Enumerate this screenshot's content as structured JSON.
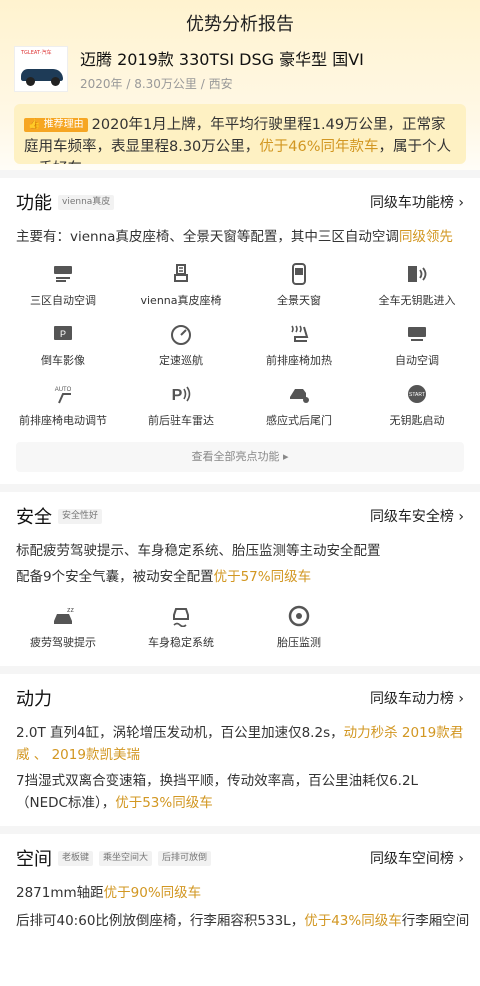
{
  "header": {
    "title": "优势分析报告"
  },
  "car": {
    "thumb_tag": "TGLEAT·汽车",
    "name": "迈腾 2019款 330TSI DSG 豪华型 国VI",
    "meta": "2020年 / 8.30万公里 / 西安"
  },
  "recommend": {
    "badge": "推荐理由",
    "text1": "2020年1月上牌，年平均行驶里程1.49万公里，正常家庭用车频率，表显里程8.30万公里，",
    "highlight": "优于46%同年款车",
    "text2": "，属于个人一手好车"
  },
  "function": {
    "title": "功能",
    "chip": "vienna真皮",
    "rank": "同级车功能榜 ›",
    "summary": "主要有：vienna真皮座椅、全景天窗等配置，其中三区自动空调",
    "summary_hl": "同级领先",
    "features": [
      {
        "label": "三区自动空调",
        "icon": "climate-icon"
      },
      {
        "label": "vienna真皮座椅",
        "icon": "seat-icon"
      },
      {
        "label": "全景天窗",
        "icon": "sunroof-icon"
      },
      {
        "label": "全车无钥匙进入",
        "icon": "keyless-entry-icon"
      },
      {
        "label": "倒车影像",
        "icon": "reverse-camera-icon"
      },
      {
        "label": "定速巡航",
        "icon": "cruise-icon"
      },
      {
        "label": "前排座椅加热",
        "icon": "seat-heat-icon"
      },
      {
        "label": "自动空调",
        "icon": "auto-ac-icon"
      },
      {
        "label": "前排座椅电动调节",
        "icon": "power-seat-icon"
      },
      {
        "label": "前后驻车雷达",
        "icon": "parking-radar-icon"
      },
      {
        "label": "感应式后尾门",
        "icon": "tailgate-icon"
      },
      {
        "label": "无钥匙启动",
        "icon": "start-button-icon"
      }
    ],
    "more": "查看全部亮点功能 ▸"
  },
  "safety": {
    "title": "安全",
    "chip": "安全性好",
    "rank": "同级车安全榜 ›",
    "line1": "标配疲劳驾驶提示、车身稳定系统、胎压监测等主动安全配置",
    "line2": "配备9个安全气囊，被动安全配置",
    "line2_hl": "优于57%同级车",
    "features": [
      {
        "label": "疲劳驾驶提示",
        "icon": "fatigue-icon"
      },
      {
        "label": "车身稳定系统",
        "icon": "esp-icon"
      },
      {
        "label": "胎压监测",
        "icon": "tire-pressure-icon"
      }
    ]
  },
  "power": {
    "title": "动力",
    "rank": "同级车动力榜 ›",
    "p1a": "2.0T 直列4缸，涡轮增压发动机，百公里加速仅8.2s，",
    "p1hl": "动力秒杀 2019款君威 、 2019款凯美瑞",
    "p2a": "7挡湿式双离合变速箱，换挡平顺，传动效率高，百公里油耗仅6.2L（NEDC标准），",
    "p2hl": "优于53%同级车"
  },
  "space": {
    "title": "空间",
    "chips": [
      "老板键",
      "乘坐空间大",
      "后排可放倒"
    ],
    "rank": "同级车空间榜 ›",
    "l1a": "2871mm轴距",
    "l1hl": "优于90%同级车",
    "l2a": "后排可40:60比例放倒座椅，行李厢容积533L，",
    "l2hl": "优于43%同级车",
    "l2b": "行李厢空间"
  }
}
